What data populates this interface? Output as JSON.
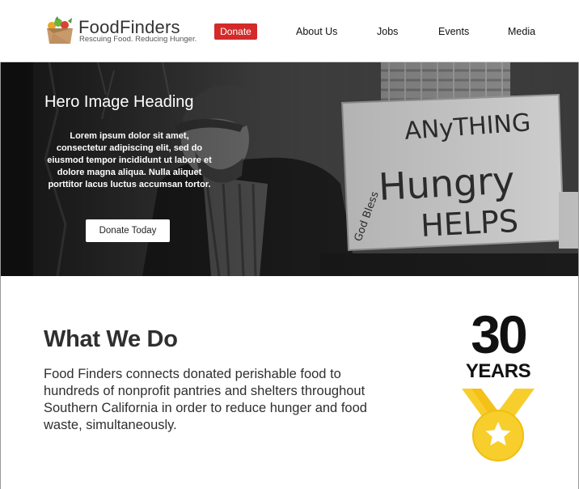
{
  "brand": {
    "name": "FoodFinders",
    "tagline": "Rescuing Food. Reducing Hunger."
  },
  "header": {
    "donate_label": "Donate",
    "nav": [
      {
        "label": "About Us"
      },
      {
        "label": "Jobs"
      },
      {
        "label": "Events"
      },
      {
        "label": "Media"
      }
    ]
  },
  "hero": {
    "heading": "Hero Image Heading",
    "text": "Lorem ipsum dolor sit amet, consectetur adipiscing elit, sed do eiusmod tempor incididunt ut labore et dolore magna aliqua. Nulla aliquet porttitor lacus luctus accumsan tortor.",
    "cta_label": "Donate Today",
    "sign": {
      "line1": "ANyTHING",
      "line2": "Hungry",
      "line3": "HELPS",
      "corner": "God Bless"
    }
  },
  "what_we_do": {
    "title": "What We Do",
    "body": "Food Finders connects donated perishable food to hundreds of nonprofit pantries and shelters throughout Southern California in order to reduce hunger and food waste, simultaneously."
  },
  "anniversary": {
    "number": "30",
    "word": "YEARS"
  },
  "colors": {
    "donate_red": "#d32a2a",
    "medal_yellow": "#f7ce2b",
    "text_dark": "#2f2f2f"
  }
}
